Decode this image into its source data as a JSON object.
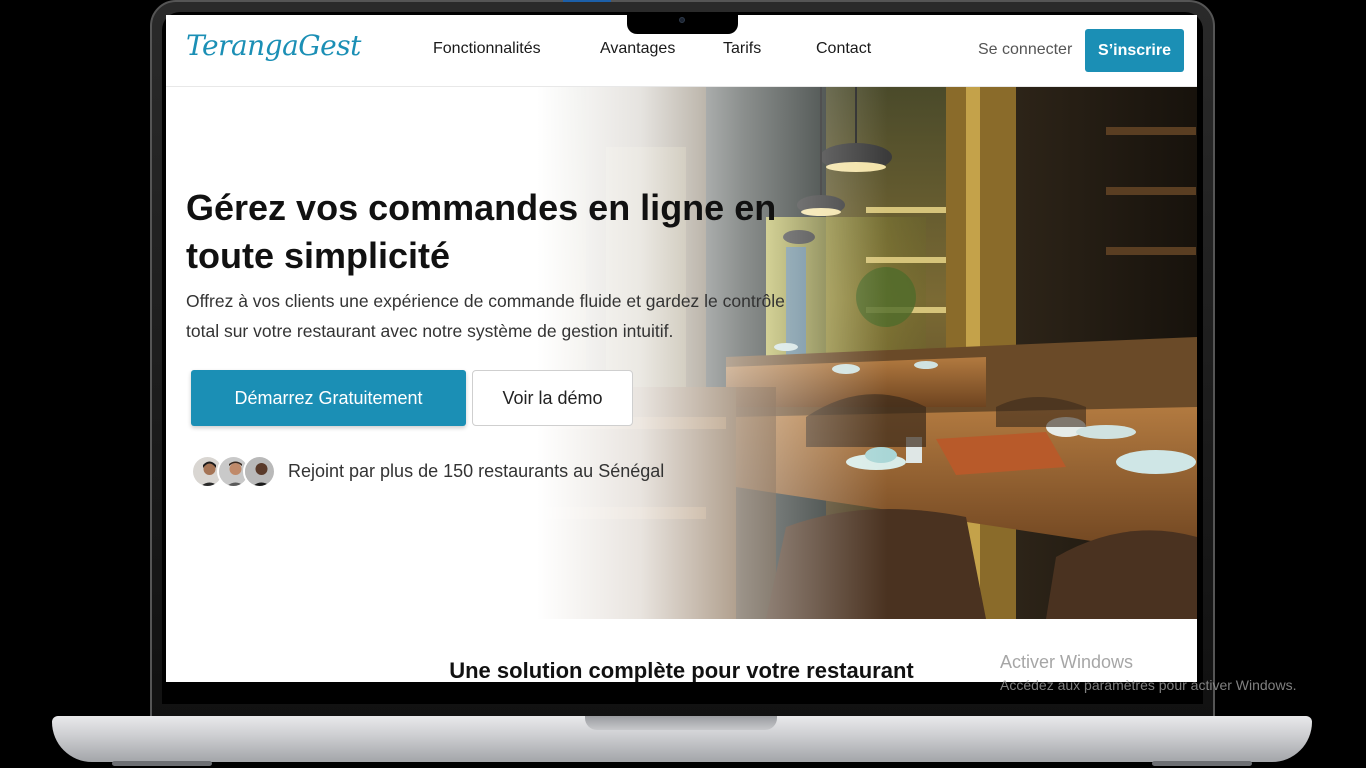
{
  "brand": {
    "logo_text": "TerangaGest"
  },
  "nav": {
    "links": [
      "Fonctionnalités",
      "Avantages",
      "Tarifs",
      "Contact"
    ],
    "login_label": "Se connecter",
    "signup_label": "S’inscrire"
  },
  "hero": {
    "title": "Gérez vos commandes en ligne en toute simplicité",
    "subtitle": "Offrez à vos clients une expérience de commande fluide et gardez le contrôle total sur votre restaurant avec notre système de gestion intuitif.",
    "primary_cta": "Démarrez Gratuitement",
    "secondary_cta": "Voir la démo",
    "social_proof": "Rejoint par plus de 150 restaurants au Sénégal"
  },
  "features": {
    "title": "Une solution complète pour votre restaurant"
  },
  "os_watermark": {
    "line1": "Activer Windows",
    "line2": "Accédez aux paramètres pour activer Windows."
  },
  "colors": {
    "accent": "#1b8fb5",
    "text": "#111111"
  }
}
